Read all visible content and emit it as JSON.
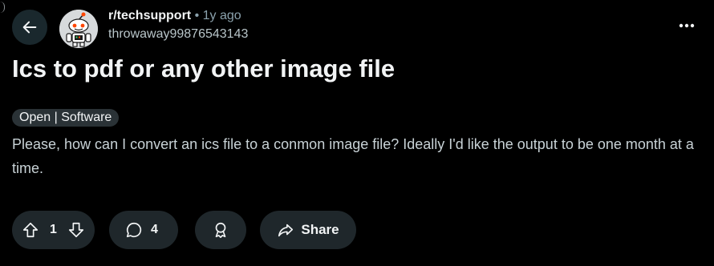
{
  "header": {
    "subreddit": "r/techsupport",
    "separator": "•",
    "age": "1y ago",
    "author": "throwaway99876543143"
  },
  "post": {
    "title": "Ics to pdf or any other image file",
    "flair": "Open | Software",
    "body": "Please, how can I convert an ics file to a conmon image file? Ideally I'd like the output to be one month at a time."
  },
  "actions": {
    "upvote_count": "1",
    "comment_count": "4",
    "share_label": "Share"
  },
  "icons": {
    "back": "arrow-left-icon",
    "avatar": "snoo-robot-icon",
    "more": "ellipsis-icon",
    "upvote": "arrow-up-icon",
    "downvote": "arrow-down-icon",
    "comment": "speech-bubble-icon",
    "award": "award-icon",
    "share": "share-arrow-icon"
  },
  "colors": {
    "background": "#000000",
    "button_bg": "#1f272b",
    "back_bg": "#1a282d",
    "flair_bg": "#2a3236",
    "text_primary": "#f2f4f5",
    "text_secondary": "#8ba2ad"
  }
}
